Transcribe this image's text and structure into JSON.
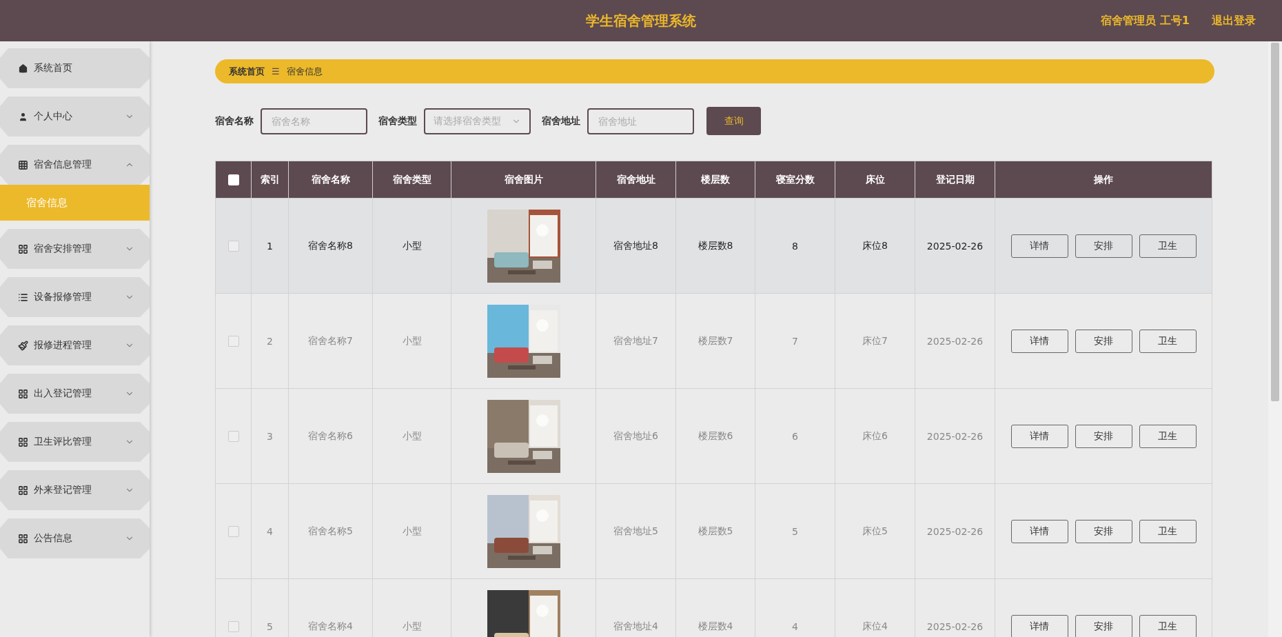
{
  "header": {
    "title": "学生宿舍管理系统",
    "user": "宿舍管理员 工号1",
    "logout": "退出登录"
  },
  "sidebar": {
    "items": [
      {
        "label": "系统首页",
        "expandable": false,
        "expanded": false
      },
      {
        "label": "个人中心",
        "expandable": true,
        "expanded": false
      },
      {
        "label": "宿舍信息管理",
        "expandable": true,
        "expanded": true,
        "children": [
          {
            "label": "宿舍信息",
            "selected": true
          }
        ]
      },
      {
        "label": "宿舍安排管理",
        "expandable": true,
        "expanded": false
      },
      {
        "label": "设备报修管理",
        "expandable": true,
        "expanded": false
      },
      {
        "label": "报修进程管理",
        "expandable": true,
        "expanded": false
      },
      {
        "label": "出入登记管理",
        "expandable": true,
        "expanded": false
      },
      {
        "label": "卫生评比管理",
        "expandable": true,
        "expanded": false
      },
      {
        "label": "外来登记管理",
        "expandable": true,
        "expanded": false
      },
      {
        "label": "公告信息",
        "expandable": true,
        "expanded": false
      }
    ]
  },
  "breadcrumb": {
    "items": [
      "系统首页",
      "宿舍信息"
    ],
    "separator": "☰"
  },
  "search": {
    "fields": [
      {
        "label": "宿舍名称",
        "kind": "input",
        "placeholder": "宿舍名称"
      },
      {
        "label": "宿舍类型",
        "kind": "select",
        "placeholder": "请选择宿舍类型"
      },
      {
        "label": "宿舍地址",
        "kind": "input",
        "placeholder": "宿舍地址"
      }
    ],
    "button": "查询"
  },
  "table": {
    "select_all": false,
    "columns": [
      "索引",
      "宿舍名称",
      "宿舍类型",
      "宿舍图片",
      "宿舍地址",
      "楼层数",
      "寝室分数",
      "床位",
      "登记日期",
      "操作"
    ],
    "rows": [
      {
        "checked": false,
        "highlighted": true,
        "cells": [
          "1",
          "宿舍名称8",
          "小型",
          {
            "kind": "picture"
          },
          "宿舍地址8",
          "楼层数8",
          "8",
          "床位8",
          "2025-02-26"
        ],
        "actions": [
          "详情",
          "安排",
          "卫生"
        ]
      },
      {
        "checked": false,
        "highlighted": false,
        "cells": [
          "2",
          "宿舍名称7",
          "小型",
          {
            "kind": "picture"
          },
          "宿舍地址7",
          "楼层数7",
          "7",
          "床位7",
          "2025-02-26"
        ],
        "actions": [
          "详情",
          "安排",
          "卫生"
        ]
      },
      {
        "checked": false,
        "highlighted": false,
        "cells": [
          "3",
          "宿舍名称6",
          "小型",
          {
            "kind": "picture"
          },
          "宿舍地址6",
          "楼层数6",
          "6",
          "床位6",
          "2025-02-26"
        ],
        "actions": [
          "详情",
          "安排",
          "卫生"
        ]
      },
      {
        "checked": false,
        "highlighted": false,
        "cells": [
          "4",
          "宿舍名称5",
          "小型",
          {
            "kind": "picture"
          },
          "宿舍地址5",
          "楼层数5",
          "5",
          "床位5",
          "2025-02-26"
        ],
        "actions": [
          "详情",
          "安排",
          "卫生"
        ]
      },
      {
        "checked": false,
        "highlighted": false,
        "cells": [
          "5",
          "宿舍名称4",
          "小型",
          {
            "kind": "picture"
          },
          "宿舍地址4",
          "楼层数4",
          "4",
          "床位4",
          "2025-02-26"
        ],
        "actions": [
          "详情",
          "安排",
          "卫生"
        ]
      }
    ]
  }
}
